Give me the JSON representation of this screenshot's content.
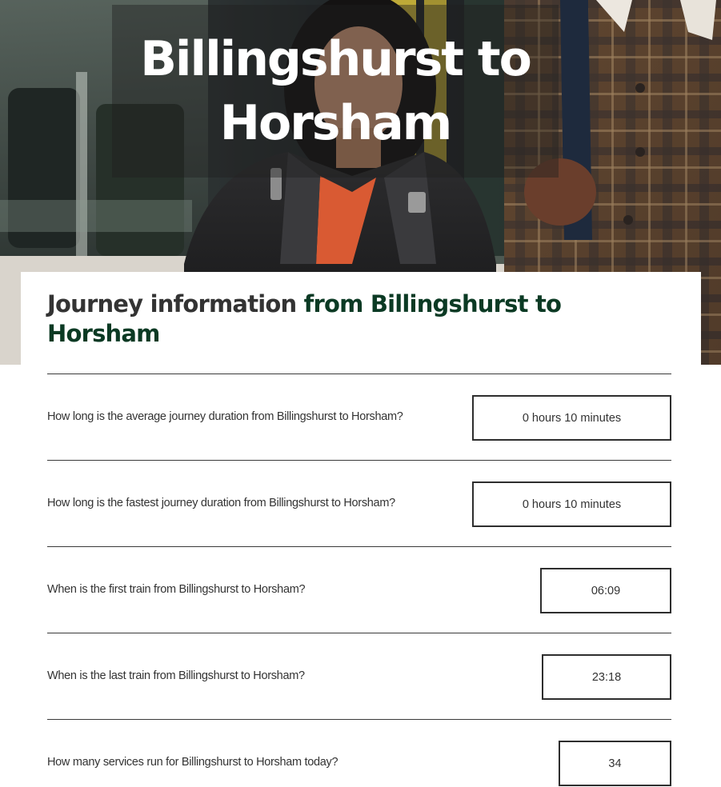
{
  "hero": {
    "title": "Billingshurst to Horsham"
  },
  "journey_info": {
    "heading_lead": "Journey information",
    "heading_accent": "from Billingshurst to Horsham"
  },
  "faq": [
    {
      "question": "How long is the average journey duration from Billingshurst to Horsham?",
      "answer": "0 hours 10 minutes"
    },
    {
      "question": "How long is the fastest journey duration from Billingshurst to Horsham?",
      "answer": "0 hours 10 minutes"
    },
    {
      "question": "When is the first train from Billingshurst to Horsham?",
      "answer": "06:09"
    },
    {
      "question": "When is the last train from Billingshurst to Horsham?",
      "answer": "23:18"
    },
    {
      "question": "How many services run for Billingshurst to Horsham today?",
      "answer": "34"
    }
  ],
  "colors": {
    "accent_green": "#0b3a24",
    "text_dark": "#333333",
    "border": "#2e2e2e"
  }
}
